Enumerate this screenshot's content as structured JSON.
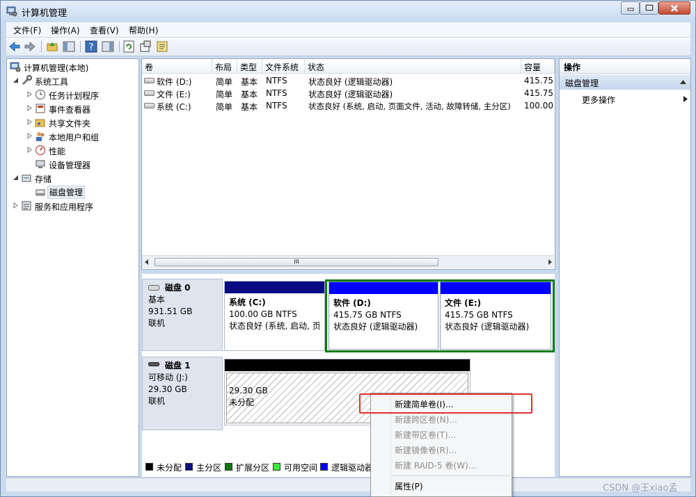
{
  "window": {
    "title": "计算机管理"
  },
  "menu": [
    {
      "label": "文件(F)"
    },
    {
      "label": "操作(A)"
    },
    {
      "label": "查看(V)"
    },
    {
      "label": "帮助(H)"
    }
  ],
  "tree": {
    "root": "计算机管理(本地)",
    "system_tools": "系统工具",
    "task_scheduler": "任务计划程序",
    "event_viewer": "事件查看器",
    "shared_folders": "共享文件夹",
    "local_users": "本地用户和组",
    "performance": "性能",
    "device_manager": "设备管理器",
    "storage": "存储",
    "disk_management": "磁盘管理",
    "services_apps": "服务和应用程序"
  },
  "volume_list": {
    "headers": [
      "卷",
      "布局",
      "类型",
      "文件系统",
      "状态",
      "容量"
    ],
    "rows": [
      {
        "name": "软件 (D:)",
        "layout": "简单",
        "type": "基本",
        "fs": "NTFS",
        "status": "状态良好 (逻辑驱动器)",
        "capacity": "415.75 ("
      },
      {
        "name": "文件 (E:)",
        "layout": "简单",
        "type": "基本",
        "fs": "NTFS",
        "status": "状态良好 (逻辑驱动器)",
        "capacity": "415.75 ("
      },
      {
        "name": "系统 (C:)",
        "layout": "简单",
        "type": "基本",
        "fs": "NTFS",
        "status": "状态良好 (系统, 启动, 页面文件, 活动, 故障转储, 主分区)",
        "capacity": "100.00 ("
      }
    ],
    "scroll_thumb": "III"
  },
  "disks": [
    {
      "name": "磁盘 0",
      "kind": "基本",
      "size": "931.51 GB",
      "state": "联机",
      "volumes": [
        {
          "title": "系统 (C:)",
          "size": "100.00 GB NTFS",
          "status": "状态良好 (系统, 启动, 页",
          "bar_color": "#0a0a82"
        },
        {
          "title": "软件 (D:)",
          "size": "415.75 GB NTFS",
          "status": "状态良好 (逻辑驱动器)",
          "bar_color": "#0000ff"
        },
        {
          "title": "文件 (E:)",
          "size": "415.75 GB NTFS",
          "status": "状态良好 (逻辑驱动器)",
          "bar_color": "#0000ff"
        }
      ]
    },
    {
      "name": "磁盘 1",
      "kind": "可移动 (J:)",
      "size": "29.30 GB",
      "state": "联机",
      "volumes": [
        {
          "title": "",
          "size": "29.30 GB",
          "status": "未分配",
          "bar_color": "#000000"
        }
      ]
    }
  ],
  "legend": [
    {
      "label": "未分配",
      "color": "#000000"
    },
    {
      "label": "主分区",
      "color": "#0a0a82"
    },
    {
      "label": "扩展分区",
      "color": "#0a7a0a"
    },
    {
      "label": "可用空间",
      "color": "#33ee33"
    },
    {
      "label": "逻辑驱动器",
      "color": "#0000ff"
    }
  ],
  "actions": {
    "header": "操作",
    "section": "磁盘管理",
    "more": "更多操作"
  },
  "context_menu": {
    "items": [
      {
        "label": "新建简单卷(I)...",
        "enabled": true
      },
      {
        "label": "新建跨区卷(N)...",
        "enabled": false
      },
      {
        "label": "新建带区卷(T)...",
        "enabled": false
      },
      {
        "label": "新建镜像卷(R)...",
        "enabled": false
      },
      {
        "label": "新建 RAID-5 卷(W)...",
        "enabled": false
      },
      {
        "label": "属性(P)",
        "enabled": true
      }
    ]
  },
  "watermark": "CSDN @王xiao孟",
  "icons": {
    "back": "back-arrow-icon",
    "forward": "forward-arrow-icon",
    "up": "up-folder-icon",
    "show_tree": "console-tree-icon",
    "help": "help-icon",
    "action_pane": "action-pane-icon",
    "refresh": "refresh-icon",
    "properties": "properties-icon",
    "export": "export-icon"
  }
}
